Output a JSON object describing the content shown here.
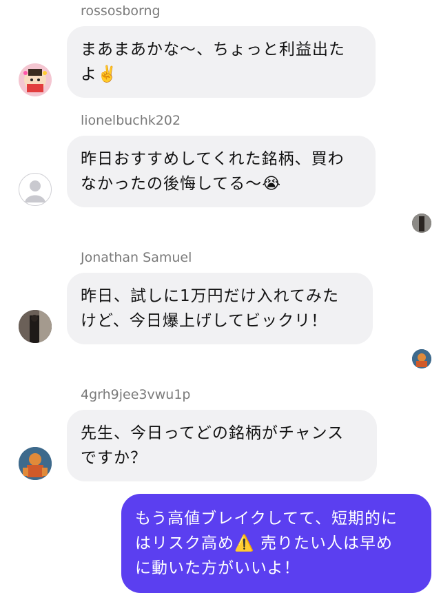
{
  "messages": [
    {
      "user": "rossosborng",
      "text": "まあまあかな〜、ちょっと利益出た\nよ✌️",
      "avatar_icon": "cartoon-avatar-icon"
    },
    {
      "user": "lionelbuchk202",
      "text": "昨日おすすめしてくれた銘柄、買わ\nなかったの後悔してる〜😭",
      "avatar_icon": "default-person-avatar-icon"
    },
    {
      "user": "Jonathan Samuel",
      "text": "昨日、試しに1万円だけ入れてみた\nけど、今日爆上げしてビックリ！",
      "avatar_icon": "photo-avatar-icon"
    },
    {
      "user": "4grh9jee3vwu1p",
      "text": "先生、今日ってどの銘柄がチャンス\nですか？",
      "avatar_icon": "superhero-avatar-icon"
    }
  ],
  "my_message": {
    "text": "もう高値ブレイクしてて、短期的に\nはリスク高め⚠️ 売りたい人は早め\nに動いた方がいいよ！"
  },
  "colors": {
    "my_bubble": "#5b3ff0",
    "other_bubble": "#f1f1f3",
    "username": "#7a7a7a"
  }
}
